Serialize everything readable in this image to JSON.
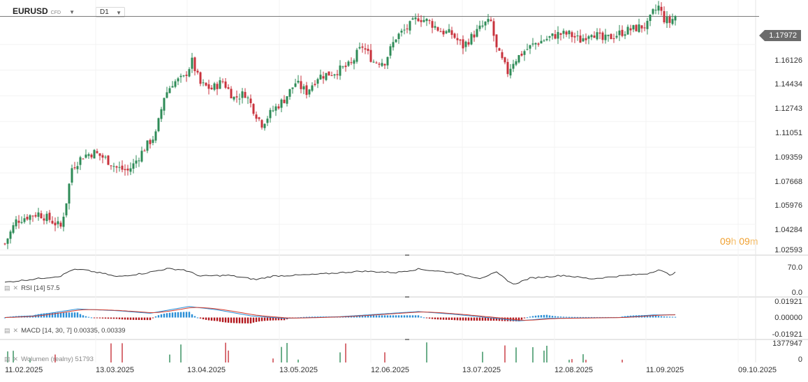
{
  "toolbar": {
    "symbol": "EURUSD",
    "symbol_type": "CFD",
    "timeframe": "D1"
  },
  "price_axis": {
    "labels": [
      "1.16126",
      "1.14434",
      "1.12743",
      "1.11051",
      "1.09359",
      "1.07668",
      "1.05976",
      "1.04284",
      "1.02593"
    ],
    "current_price": "1.17972"
  },
  "countdown": {
    "hours": "09",
    "h": "h",
    "minutes": "09",
    "m": "m"
  },
  "rsi": {
    "label": "RSI [14] 57.5",
    "axis": [
      "70.0",
      "0.0"
    ]
  },
  "macd": {
    "label": "MACD [14, 30, 7] 0.00335, 0.00339",
    "axis": [
      "0.01921",
      "0.00000",
      "-0.01921"
    ]
  },
  "volume": {
    "label": "Wolumen (realny) 51793",
    "axis": [
      "1377947",
      "0"
    ]
  },
  "dates": [
    "11.02.2025",
    "13.03.2025",
    "13.04.2025",
    "13.05.2025",
    "12.06.2025",
    "13.07.2025",
    "12.08.2025",
    "11.09.2025",
    "09.10.2025"
  ],
  "colors": {
    "up": "#2e8b57",
    "down": "#c8323c",
    "macd_line": "#2a8fd6",
    "signal_line": "#d33a2c",
    "rsi_line": "#333333"
  },
  "chart_data": {
    "type": "candlestick",
    "symbol": "EURUSD",
    "timeframe": "D1",
    "anchors": [
      [
        0,
        1.03
      ],
      [
        4,
        1.045
      ],
      [
        8,
        1.048
      ],
      [
        12,
        1.05
      ],
      [
        16,
        1.046
      ],
      [
        20,
        1.041
      ],
      [
        22,
        1.058
      ],
      [
        24,
        1.08
      ],
      [
        28,
        1.088
      ],
      [
        32,
        1.09
      ],
      [
        36,
        1.086
      ],
      [
        40,
        1.08
      ],
      [
        44,
        1.078
      ],
      [
        46,
        1.082
      ],
      [
        50,
        1.093
      ],
      [
        54,
        1.102
      ],
      [
        57,
        1.127
      ],
      [
        60,
        1.136
      ],
      [
        64,
        1.139
      ],
      [
        67,
        1.15
      ],
      [
        70,
        1.135
      ],
      [
        74,
        1.132
      ],
      [
        78,
        1.137
      ],
      [
        82,
        1.126
      ],
      [
        86,
        1.129
      ],
      [
        90,
        1.115
      ],
      [
        92,
        1.109
      ],
      [
        96,
        1.118
      ],
      [
        100,
        1.125
      ],
      [
        104,
        1.136
      ],
      [
        108,
        1.13
      ],
      [
        112,
        1.14
      ],
      [
        118,
        1.143
      ],
      [
        124,
        1.148
      ],
      [
        126,
        1.155
      ],
      [
        128,
        1.16
      ],
      [
        132,
        1.15
      ],
      [
        136,
        1.15
      ],
      [
        140,
        1.166
      ],
      [
        144,
        1.172
      ],
      [
        148,
        1.179
      ],
      [
        152,
        1.176
      ],
      [
        156,
        1.17
      ],
      [
        160,
        1.168
      ],
      [
        164,
        1.16
      ],
      [
        168,
        1.168
      ],
      [
        172,
        1.175
      ],
      [
        174,
        1.176
      ],
      [
        176,
        1.158
      ],
      [
        180,
        1.143
      ],
      [
        182,
        1.15
      ],
      [
        186,
        1.157
      ],
      [
        190,
        1.162
      ],
      [
        194,
        1.165
      ],
      [
        198,
        1.168
      ],
      [
        202,
        1.168
      ],
      [
        206,
        1.164
      ],
      [
        210,
        1.17
      ],
      [
        214,
        1.164
      ],
      [
        218,
        1.167
      ],
      [
        222,
        1.17
      ],
      [
        226,
        1.172
      ],
      [
        230,
        1.174
      ],
      [
        232,
        1.182
      ],
      [
        234,
        1.186
      ],
      [
        236,
        1.178
      ],
      [
        238,
        1.176
      ],
      [
        240,
        1.18
      ]
    ],
    "rsi_anchors": [
      [
        0,
        30
      ],
      [
        20,
        48
      ],
      [
        24,
        66
      ],
      [
        28,
        66
      ],
      [
        36,
        54
      ],
      [
        40,
        46
      ],
      [
        50,
        56
      ],
      [
        58,
        69
      ],
      [
        64,
        66
      ],
      [
        70,
        48
      ],
      [
        80,
        50
      ],
      [
        90,
        38
      ],
      [
        96,
        48
      ],
      [
        110,
        52
      ],
      [
        128,
        62
      ],
      [
        140,
        58
      ],
      [
        148,
        68
      ],
      [
        160,
        58
      ],
      [
        170,
        42
      ],
      [
        176,
        58
      ],
      [
        182,
        24
      ],
      [
        188,
        42
      ],
      [
        200,
        50
      ],
      [
        210,
        40
      ],
      [
        220,
        48
      ],
      [
        230,
        55
      ],
      [
        234,
        66
      ],
      [
        238,
        52
      ],
      [
        240,
        57.5
      ]
    ],
    "macd_anchors": [
      [
        0,
        0.0
      ],
      [
        10,
        0.002
      ],
      [
        26,
        0.01
      ],
      [
        40,
        0.008
      ],
      [
        52,
        0.005
      ],
      [
        66,
        0.013
      ],
      [
        76,
        0.009
      ],
      [
        88,
        0.002
      ],
      [
        100,
        -0.001
      ],
      [
        120,
        0.001
      ],
      [
        148,
        0.007
      ],
      [
        160,
        0.004
      ],
      [
        176,
        -0.001
      ],
      [
        184,
        -0.004
      ],
      [
        194,
        -0.001
      ],
      [
        220,
        0.0
      ],
      [
        232,
        0.003
      ],
      [
        240,
        0.00335
      ]
    ],
    "ylim": [
      1.0225,
      1.1905
    ],
    "y_ticks": [
      1.02593,
      1.04284,
      1.05976,
      1.07668,
      1.09359,
      1.11051,
      1.12743,
      1.14434,
      1.16126
    ],
    "current_price": 1.17972,
    "rsi_ylim": [
      0,
      100
    ],
    "macd_ylim": [
      -0.01921,
      0.01921
    ],
    "macd_params": [
      14,
      30,
      7
    ],
    "macd_values": [
      0.00335,
      0.00339
    ],
    "volume_max": 1377947,
    "volume_last": 51793
  }
}
